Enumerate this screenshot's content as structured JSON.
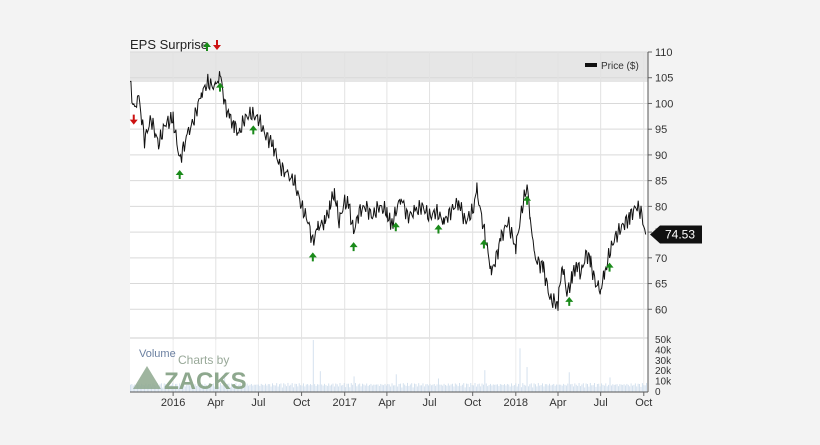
{
  "header": {
    "title": "EPS Surprise"
  },
  "legend": {
    "label": "Price ($)"
  },
  "current_price": "74.53",
  "volume": {
    "label": "Volume"
  },
  "branding": {
    "top": "Charts by",
    "name": "ZACKS"
  },
  "colors": {
    "price_line": "#111111",
    "beat": "#1a8a1a",
    "miss": "#cc1111",
    "volume": "#b7cde3",
    "badge": "#111111"
  },
  "icons": {
    "beat": "green-up-arrow-icon",
    "miss": "red-down-arrow-icon"
  },
  "chart_data": {
    "type": "line",
    "series": [
      {
        "name": "Price ($)",
        "points": [
          [
            "2015-10-01",
            104
          ],
          [
            "2015-10-09",
            99
          ],
          [
            "2015-10-20",
            101
          ],
          [
            "2015-11-01",
            93
          ],
          [
            "2015-11-15",
            97
          ],
          [
            "2015-12-01",
            92
          ],
          [
            "2015-12-15",
            96
          ],
          [
            "2016-01-01",
            97
          ],
          [
            "2016-01-15",
            89
          ],
          [
            "2016-02-01",
            94
          ],
          [
            "2016-02-15",
            97
          ],
          [
            "2016-03-01",
            102
          ],
          [
            "2016-03-15",
            104
          ],
          [
            "2016-04-01",
            103
          ],
          [
            "2016-04-10",
            106
          ],
          [
            "2016-04-20",
            100
          ],
          [
            "2016-05-01",
            97
          ],
          [
            "2016-05-10",
            96
          ],
          [
            "2016-05-20",
            94
          ],
          [
            "2016-06-01",
            97
          ],
          [
            "2016-06-15",
            98
          ],
          [
            "2016-07-01",
            97
          ],
          [
            "2016-07-15",
            94
          ],
          [
            "2016-08-01",
            92
          ],
          [
            "2016-08-15",
            88
          ],
          [
            "2016-09-01",
            86
          ],
          [
            "2016-09-15",
            85
          ],
          [
            "2016-10-01",
            80
          ],
          [
            "2016-10-15",
            77
          ],
          [
            "2016-10-25",
            73
          ],
          [
            "2016-11-05",
            76
          ],
          [
            "2016-11-20",
            77
          ],
          [
            "2016-12-01",
            80
          ],
          [
            "2016-12-10",
            83
          ],
          [
            "2016-12-20",
            77
          ],
          [
            "2017-01-01",
            81
          ],
          [
            "2017-01-10",
            80
          ],
          [
            "2017-01-20",
            75
          ],
          [
            "2017-02-01",
            79
          ],
          [
            "2017-02-15",
            80
          ],
          [
            "2017-03-01",
            78
          ],
          [
            "2017-03-15",
            80
          ],
          [
            "2017-04-01",
            79
          ],
          [
            "2017-04-10",
            76
          ],
          [
            "2017-05-01",
            82
          ],
          [
            "2017-05-15",
            78
          ],
          [
            "2017-06-01",
            79
          ],
          [
            "2017-06-15",
            80
          ],
          [
            "2017-07-01",
            78
          ],
          [
            "2017-07-15",
            79
          ],
          [
            "2017-08-01",
            77
          ],
          [
            "2017-08-15",
            79
          ],
          [
            "2017-09-01",
            81
          ],
          [
            "2017-09-15",
            77
          ],
          [
            "2017-10-01",
            79
          ],
          [
            "2017-10-10",
            83
          ],
          [
            "2017-10-20",
            78
          ],
          [
            "2017-11-01",
            72
          ],
          [
            "2017-11-10",
            67
          ],
          [
            "2017-11-20",
            70
          ],
          [
            "2017-12-01",
            74
          ],
          [
            "2017-12-15",
            77
          ],
          [
            "2018-01-01",
            72
          ],
          [
            "2018-01-15",
            80
          ],
          [
            "2018-01-25",
            84
          ],
          [
            "2018-02-01",
            78
          ],
          [
            "2018-02-10",
            70
          ],
          [
            "2018-02-20",
            69
          ],
          [
            "2018-03-01",
            68
          ],
          [
            "2018-03-15",
            62
          ],
          [
            "2018-04-01",
            61
          ],
          [
            "2018-04-10",
            69
          ],
          [
            "2018-04-20",
            63
          ],
          [
            "2018-05-01",
            66
          ],
          [
            "2018-05-10",
            69
          ],
          [
            "2018-05-20",
            67
          ],
          [
            "2018-06-01",
            71
          ],
          [
            "2018-06-10",
            69
          ],
          [
            "2018-06-20",
            65
          ],
          [
            "2018-07-01",
            64
          ],
          [
            "2018-07-10",
            67
          ],
          [
            "2018-07-20",
            71
          ],
          [
            "2018-08-01",
            74
          ],
          [
            "2018-08-15",
            76
          ],
          [
            "2018-09-01",
            78
          ],
          [
            "2018-09-15",
            80
          ],
          [
            "2018-09-25",
            79
          ],
          [
            "2018-10-05",
            74.53
          ]
        ]
      }
    ],
    "eps_surprises": [
      {
        "date": "2015-10-09",
        "type": "miss"
      },
      {
        "date": "2016-01-15",
        "type": "beat"
      },
      {
        "date": "2016-04-10",
        "type": "beat"
      },
      {
        "date": "2016-06-20",
        "type": "beat"
      },
      {
        "date": "2016-10-25",
        "type": "beat"
      },
      {
        "date": "2017-01-20",
        "type": "beat"
      },
      {
        "date": "2017-04-20",
        "type": "beat"
      },
      {
        "date": "2017-07-20",
        "type": "beat"
      },
      {
        "date": "2017-10-25",
        "type": "beat"
      },
      {
        "date": "2018-01-25",
        "type": "beat"
      },
      {
        "date": "2018-04-25",
        "type": "beat"
      },
      {
        "date": "2018-07-20",
        "type": "beat"
      }
    ],
    "x_ticks": [
      {
        "date": "2016-01-01",
        "label": "2016"
      },
      {
        "date": "2016-04-01",
        "label": "Apr"
      },
      {
        "date": "2016-07-01",
        "label": "Jul"
      },
      {
        "date": "2016-10-01",
        "label": "Oct"
      },
      {
        "date": "2017-01-01",
        "label": "2017"
      },
      {
        "date": "2017-04-01",
        "label": "Apr"
      },
      {
        "date": "2017-07-01",
        "label": "Jul"
      },
      {
        "date": "2017-10-01",
        "label": "Oct"
      },
      {
        "date": "2018-01-01",
        "label": "2018"
      },
      {
        "date": "2018-04-01",
        "label": "Apr"
      },
      {
        "date": "2018-07-01",
        "label": "Jul"
      },
      {
        "date": "2018-10-01",
        "label": "Oct"
      }
    ],
    "x_range": [
      "2015-10-01",
      "2018-10-10"
    ],
    "y_ticks": [
      60,
      65,
      70,
      75,
      80,
      85,
      90,
      95,
      100,
      105,
      110
    ],
    "ylim": [
      55,
      110
    ],
    "volume_ticks": [
      {
        "value": 0,
        "label": "0"
      },
      {
        "value": 10000,
        "label": "10k"
      },
      {
        "value": 20000,
        "label": "20k"
      },
      {
        "value": 30000,
        "label": "30k"
      },
      {
        "value": 40000,
        "label": "40k"
      },
      {
        "value": 50000,
        "label": "50k"
      }
    ],
    "volume_ylim": [
      0,
      50000
    ],
    "volume_baseline": 7000,
    "volume_spikes": [
      [
        "2016-04-20",
        18000
      ],
      [
        "2016-10-25",
        50000
      ],
      [
        "2016-11-10",
        20000
      ],
      [
        "2017-01-20",
        15000
      ],
      [
        "2017-04-20",
        17000
      ],
      [
        "2017-07-20",
        13000
      ],
      [
        "2017-10-25",
        21000
      ],
      [
        "2018-01-10",
        42000
      ],
      [
        "2018-01-25",
        24000
      ],
      [
        "2018-04-25",
        19000
      ],
      [
        "2018-07-20",
        14000
      ]
    ],
    "grid": true,
    "legend_position": "top-right"
  }
}
